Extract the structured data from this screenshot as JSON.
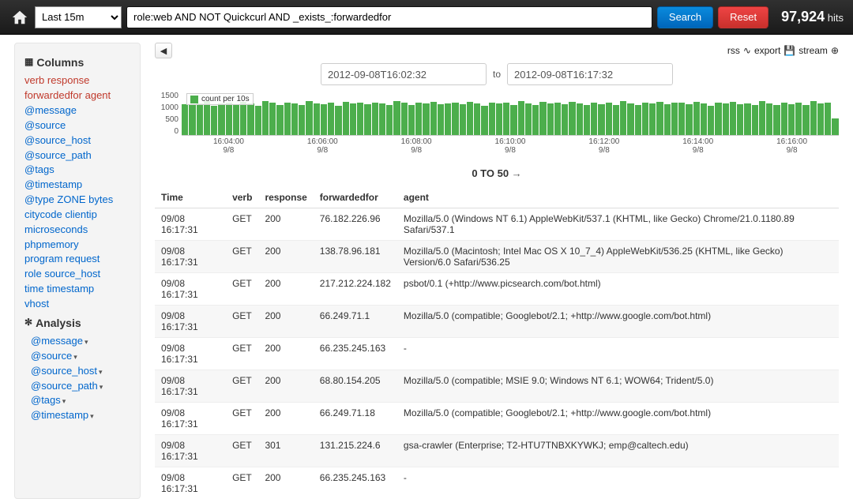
{
  "topbar": {
    "time_range": "Last 15m",
    "query": "role:web AND NOT Quickcurl AND _exists_:forwardedfor",
    "search_label": "Search",
    "reset_label": "Reset",
    "hits_count": "97,924",
    "hits_label": "hits"
  },
  "sidebar": {
    "columns_title": "Columns",
    "active_cols": [
      "verb",
      "response",
      "forwardedfor",
      "agent"
    ],
    "col_lines": [
      [
        "@message"
      ],
      [
        "@source"
      ],
      [
        "@source_host"
      ],
      [
        "@source_path"
      ],
      [
        "@tags"
      ],
      [
        "@timestamp"
      ],
      [
        "@type",
        "ZONE",
        "bytes"
      ],
      [
        "citycode",
        "clientip"
      ],
      [
        "microseconds"
      ],
      [
        "phpmemory"
      ],
      [
        "program",
        "request"
      ],
      [
        "role",
        "source_host"
      ],
      [
        "time",
        "timestamp"
      ],
      [
        "vhost"
      ]
    ],
    "analysis_title": "Analysis",
    "analysis_items": [
      "@message",
      "@source",
      "@source_host",
      "@source_path",
      "@tags",
      "@timestamp"
    ]
  },
  "toolbar": {
    "rss_label": "rss",
    "export_label": "export",
    "stream_label": "stream"
  },
  "range": {
    "from": "2012-09-08T16:02:32",
    "to_label": "to",
    "to": "2012-09-08T16:17:32"
  },
  "chart_data": {
    "type": "bar",
    "legend": "count per 10s",
    "ylim": [
      0,
      1500
    ],
    "yticks": [
      "1500",
      "1000",
      "500",
      "0"
    ],
    "values": [
      1050,
      1020,
      1080,
      1150,
      1000,
      1060,
      1100,
      1040,
      1120,
      1080,
      1000,
      1150,
      1090,
      1030,
      1100,
      1060,
      1020,
      1140,
      1080,
      1050,
      1100,
      1000,
      1120,
      1060,
      1090,
      1040,
      1110,
      1070,
      1030,
      1150,
      1090,
      1020,
      1100,
      1060,
      1120,
      1040,
      1080,
      1110,
      1050,
      1130,
      1070,
      1000,
      1100,
      1060,
      1090,
      1020,
      1150,
      1080,
      1030,
      1120,
      1060,
      1100,
      1040,
      1130,
      1070,
      1010,
      1110,
      1050,
      1090,
      1030,
      1140,
      1080,
      1020,
      1100,
      1060,
      1120,
      1040,
      1090,
      1110,
      1050,
      1130,
      1070,
      1000,
      1100,
      1060,
      1120,
      1040,
      1080,
      1030,
      1150,
      1070,
      1010,
      1110,
      1050,
      1090,
      1020,
      1140,
      1060,
      1100,
      560
    ],
    "xticks": [
      {
        "t": "16:04:00",
        "d": "9/8"
      },
      {
        "t": "16:06:00",
        "d": "9/8"
      },
      {
        "t": "16:08:00",
        "d": "9/8"
      },
      {
        "t": "16:10:00",
        "d": "9/8"
      },
      {
        "t": "16:12:00",
        "d": "9/8"
      },
      {
        "t": "16:14:00",
        "d": "9/8"
      },
      {
        "t": "16:16:00",
        "d": "9/8"
      }
    ]
  },
  "pager": {
    "label": "0 TO 50",
    "arrow": "→"
  },
  "table": {
    "headers": [
      "Time",
      "verb",
      "response",
      "forwardedfor",
      "agent"
    ],
    "rows": [
      [
        "09/08 16:17:31",
        "GET",
        "200",
        "76.182.226.96",
        "Mozilla/5.0 (Windows NT 6.1) AppleWebKit/537.1 (KHTML, like Gecko) Chrome/21.0.1180.89 Safari/537.1"
      ],
      [
        "09/08 16:17:31",
        "GET",
        "200",
        "138.78.96.181",
        "Mozilla/5.0 (Macintosh; Intel Mac OS X 10_7_4) AppleWebKit/536.25 (KHTML, like Gecko) Version/6.0 Safari/536.25"
      ],
      [
        "09/08 16:17:31",
        "GET",
        "200",
        "217.212.224.182",
        "psbot/0.1 (+http://www.picsearch.com/bot.html)"
      ],
      [
        "09/08 16:17:31",
        "GET",
        "200",
        "66.249.71.1",
        "Mozilla/5.0 (compatible; Googlebot/2.1; +http://www.google.com/bot.html)"
      ],
      [
        "09/08 16:17:31",
        "GET",
        "200",
        "66.235.245.163",
        "-"
      ],
      [
        "09/08 16:17:31",
        "GET",
        "200",
        "68.80.154.205",
        "Mozilla/5.0 (compatible; MSIE 9.0; Windows NT 6.1; WOW64; Trident/5.0)"
      ],
      [
        "09/08 16:17:31",
        "GET",
        "200",
        "66.249.71.18",
        "Mozilla/5.0 (compatible; Googlebot/2.1; +http://www.google.com/bot.html)"
      ],
      [
        "09/08 16:17:31",
        "GET",
        "301",
        "131.215.224.6",
        "gsa-crawler (Enterprise; T2-HTU7TNBXKYWKJ; emp@caltech.edu)"
      ],
      [
        "09/08 16:17:31",
        "GET",
        "200",
        "66.235.245.163",
        "-"
      ]
    ]
  }
}
